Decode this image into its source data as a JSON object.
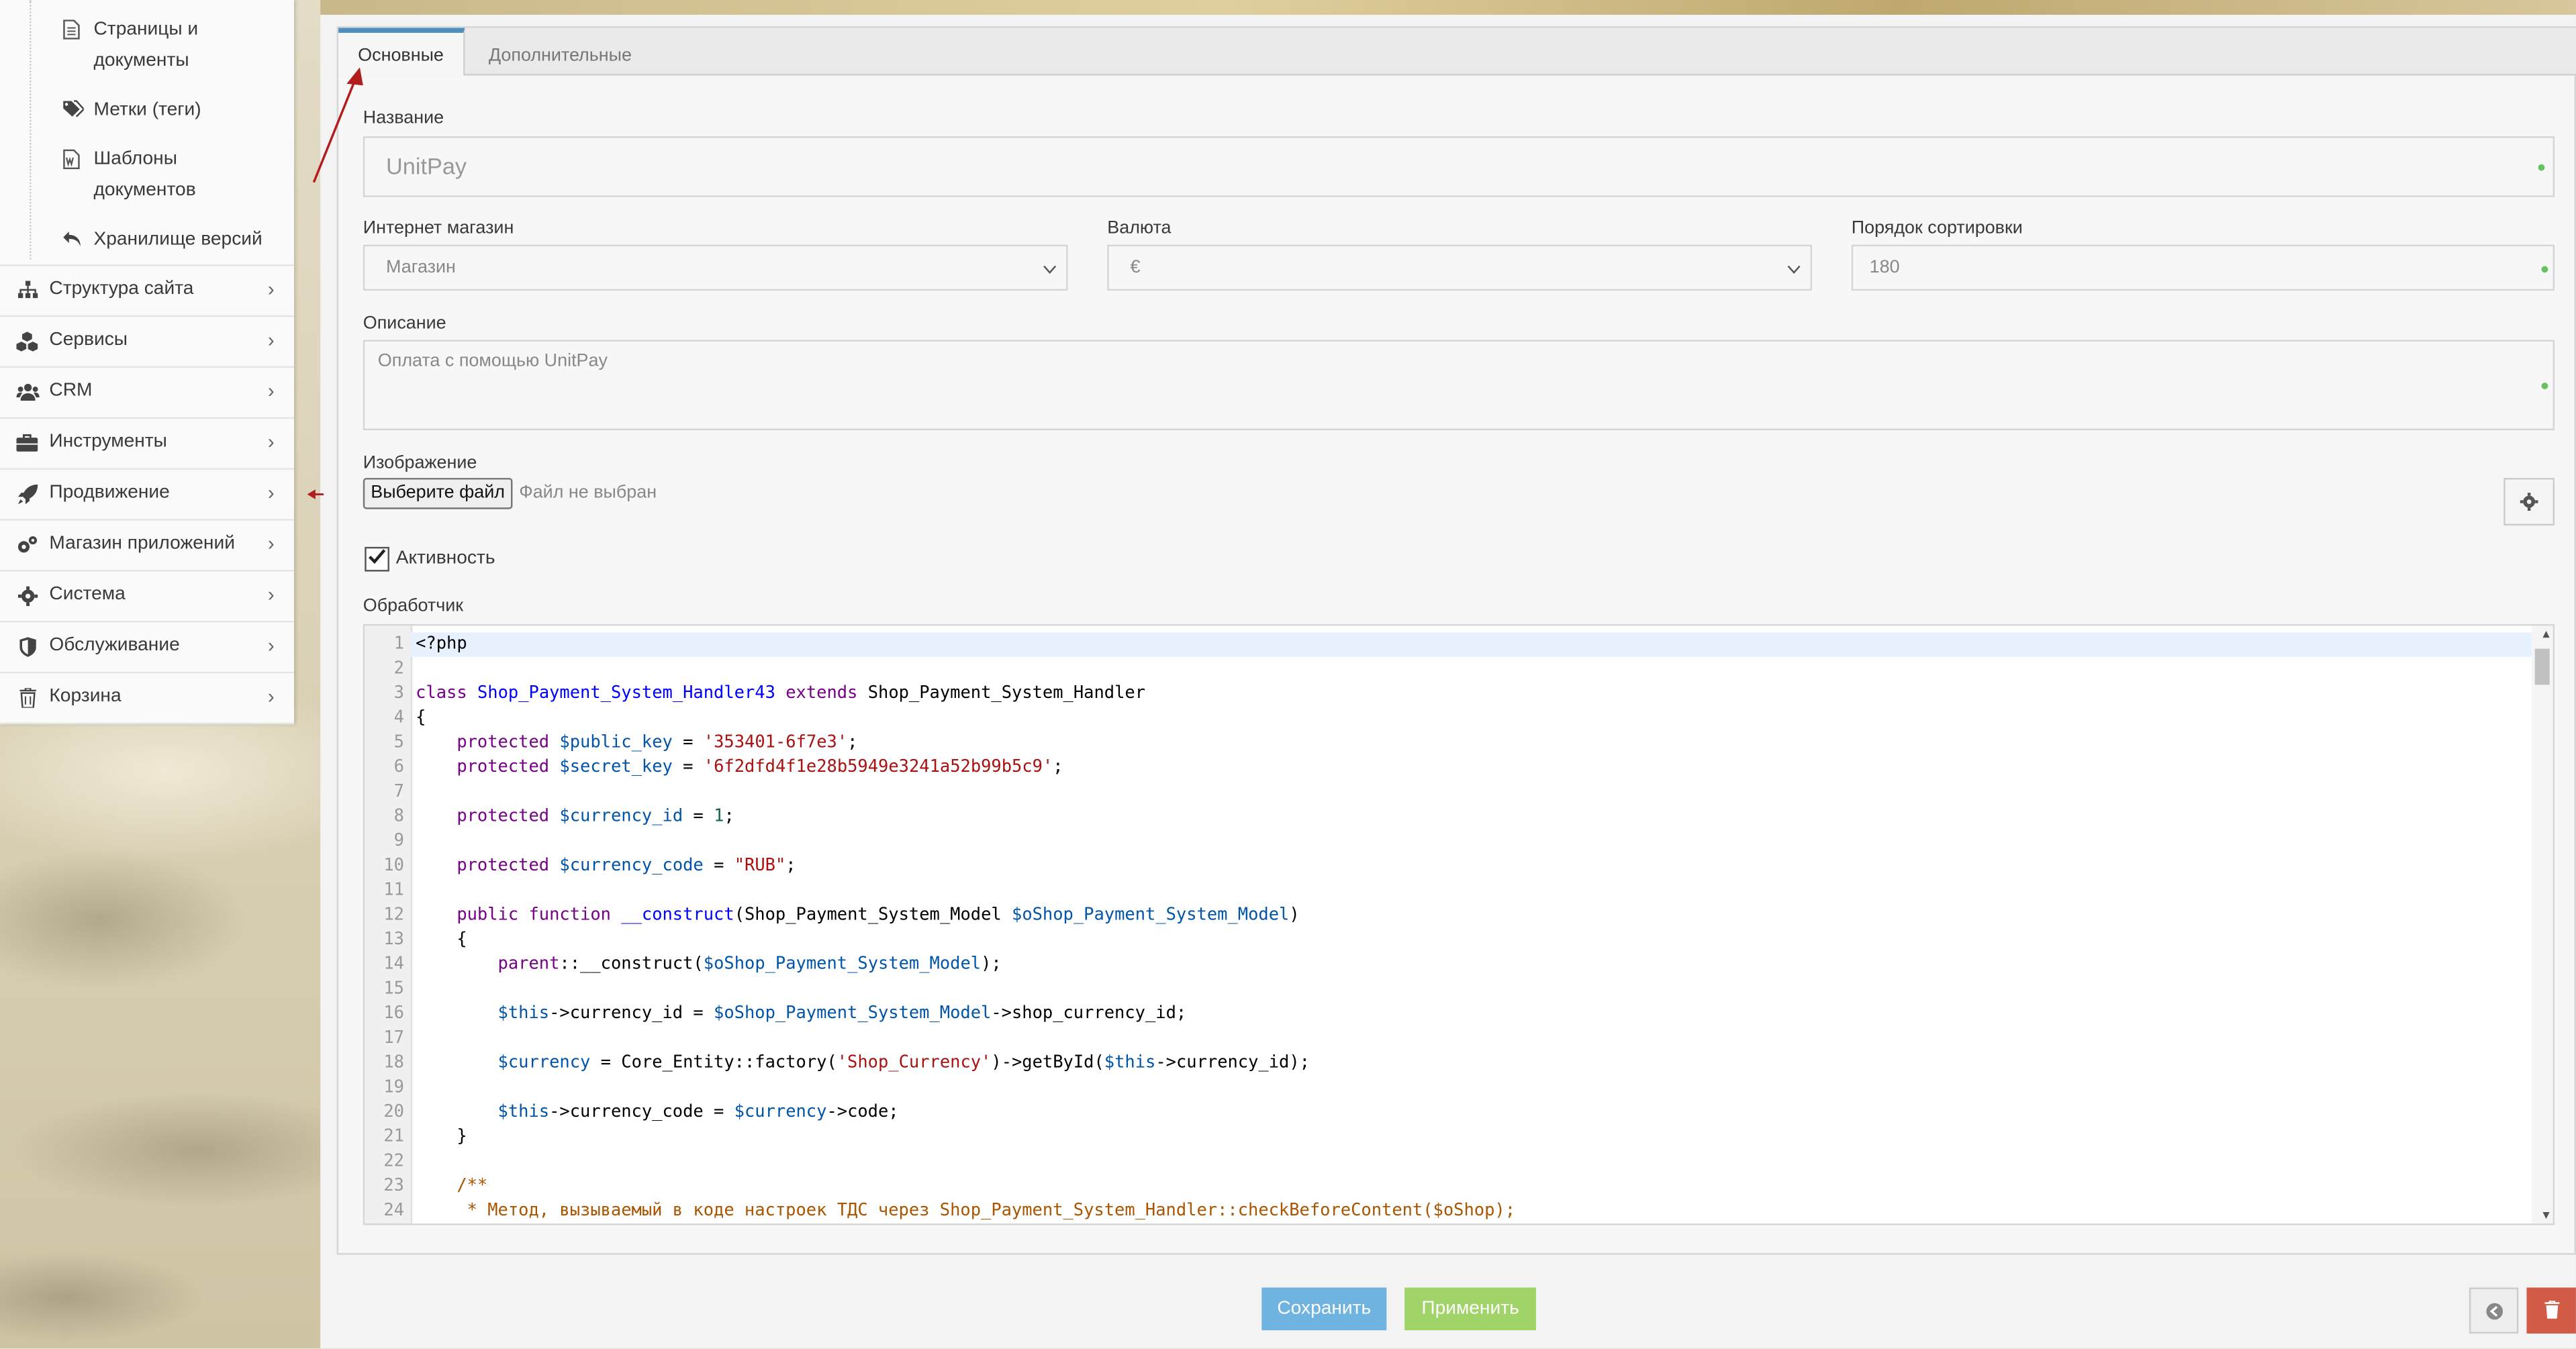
{
  "sidebar": {
    "sub_items": [
      {
        "label_line1": "Страницы и",
        "label_line2": "документы",
        "icon": "document-icon"
      },
      {
        "label_line1": "Метки (теги)",
        "label_line2": "",
        "icon": "tags-icon"
      },
      {
        "label_line1": "Шаблоны",
        "label_line2": "документов",
        "icon": "word-file-icon"
      },
      {
        "label_line1": "Хранилище версий",
        "label_line2": "",
        "icon": "undo-icon"
      }
    ],
    "menu": [
      {
        "label": "Структура сайта",
        "icon": "sitemap-icon"
      },
      {
        "label": "Сервисы",
        "icon": "cubes-icon"
      },
      {
        "label": "CRM",
        "icon": "users-icon"
      },
      {
        "label": "Инструменты",
        "icon": "briefcase-icon"
      },
      {
        "label": "Продвижение",
        "icon": "rocket-icon"
      },
      {
        "label": "Магазин приложений",
        "icon": "cogs-icon"
      },
      {
        "label": "Система",
        "icon": "gear-icon"
      },
      {
        "label": "Обслуживание",
        "icon": "shield-icon"
      },
      {
        "label": "Корзина",
        "icon": "trash-icon"
      }
    ]
  },
  "tabs": [
    "Основные",
    "Дополнительные"
  ],
  "form": {
    "name_label": "Название",
    "name_value": "UnitPay",
    "shop_label": "Интернет магазин",
    "shop_value": "Магазин",
    "currency_label": "Валюта",
    "currency_value": "€",
    "sort_label": "Порядок сортировки",
    "sort_value": "180",
    "description_label": "Описание",
    "description_value": "Оплата с помощью UnitPay",
    "image_label": "Изображение",
    "file_button": "Выберите файл",
    "file_status": "Файл не выбран",
    "active_label": "Активность",
    "active_checked": true,
    "handler_label": "Обработчик"
  },
  "code": {
    "line_numbers": [
      "1",
      "2",
      "3",
      "4",
      "5",
      "6",
      "7",
      "8",
      "9",
      "10",
      "11",
      "12",
      "13",
      "14",
      "15",
      "16",
      "17",
      "18",
      "19",
      "20",
      "21",
      "22",
      "23",
      "24"
    ],
    "lines": [
      [
        {
          "t": "<?php",
          "c": ""
        }
      ],
      [],
      [
        {
          "t": "class ",
          "c": "kw"
        },
        {
          "t": "Shop_Payment_System_Handler43",
          "c": "def"
        },
        {
          "t": " extends ",
          "c": "kw"
        },
        {
          "t": "Shop_Payment_System_Handler",
          "c": ""
        }
      ],
      [
        {
          "t": "{",
          "c": ""
        }
      ],
      [
        {
          "t": "    protected ",
          "c": "kw"
        },
        {
          "t": "$public_key",
          "c": "var"
        },
        {
          "t": " = ",
          "c": ""
        },
        {
          "t": "'353401-6f7e3'",
          "c": "str"
        },
        {
          "t": ";",
          "c": ""
        }
      ],
      [
        {
          "t": "    protected ",
          "c": "kw"
        },
        {
          "t": "$secret_key",
          "c": "var"
        },
        {
          "t": " = ",
          "c": ""
        },
        {
          "t": "'6f2dfd4f1e28b5949e3241a52b99b5c9'",
          "c": "str"
        },
        {
          "t": ";",
          "c": ""
        }
      ],
      [],
      [
        {
          "t": "    protected ",
          "c": "kw"
        },
        {
          "t": "$currency_id",
          "c": "var"
        },
        {
          "t": " = ",
          "c": ""
        },
        {
          "t": "1",
          "c": "num"
        },
        {
          "t": ";",
          "c": ""
        }
      ],
      [],
      [
        {
          "t": "    protected ",
          "c": "kw"
        },
        {
          "t": "$currency_code",
          "c": "var"
        },
        {
          "t": " = ",
          "c": ""
        },
        {
          "t": "\"RUB\"",
          "c": "str"
        },
        {
          "t": ";",
          "c": ""
        }
      ],
      [],
      [
        {
          "t": "    public function ",
          "c": "kw"
        },
        {
          "t": "__construct",
          "c": "def"
        },
        {
          "t": "(Shop_Payment_System_Model ",
          "c": ""
        },
        {
          "t": "$oShop_Payment_System_Model",
          "c": "var"
        },
        {
          "t": ")",
          "c": ""
        }
      ],
      [
        {
          "t": "    {",
          "c": ""
        }
      ],
      [
        {
          "t": "        parent",
          "c": "kw"
        },
        {
          "t": "::__construct(",
          "c": ""
        },
        {
          "t": "$oShop_Payment_System_Model",
          "c": "var"
        },
        {
          "t": ");",
          "c": ""
        }
      ],
      [],
      [
        {
          "t": "        $this",
          "c": "var"
        },
        {
          "t": "->currency_id = ",
          "c": ""
        },
        {
          "t": "$oShop_Payment_System_Model",
          "c": "var"
        },
        {
          "t": "->shop_currency_id;",
          "c": ""
        }
      ],
      [],
      [
        {
          "t": "        $currency",
          "c": "var"
        },
        {
          "t": " = Core_Entity::factory(",
          "c": ""
        },
        {
          "t": "'Shop_Currency'",
          "c": "str"
        },
        {
          "t": ")->getById(",
          "c": ""
        },
        {
          "t": "$this",
          "c": "var"
        },
        {
          "t": "->currency_id);",
          "c": ""
        }
      ],
      [],
      [
        {
          "t": "        $this",
          "c": "var"
        },
        {
          "t": "->currency_code = ",
          "c": ""
        },
        {
          "t": "$currency",
          "c": "var"
        },
        {
          "t": "->code;",
          "c": ""
        }
      ],
      [
        {
          "t": "    }",
          "c": ""
        }
      ],
      [],
      [
        {
          "t": "    /**",
          "c": "com"
        }
      ],
      [
        {
          "t": "     * Метод, вызываемый в коде настроек ТДС через Shop_Payment_System_Handler::checkBeforeContent($oShop);",
          "c": "com"
        }
      ]
    ]
  },
  "buttons": {
    "save": "Сохранить",
    "apply": "Применить"
  }
}
